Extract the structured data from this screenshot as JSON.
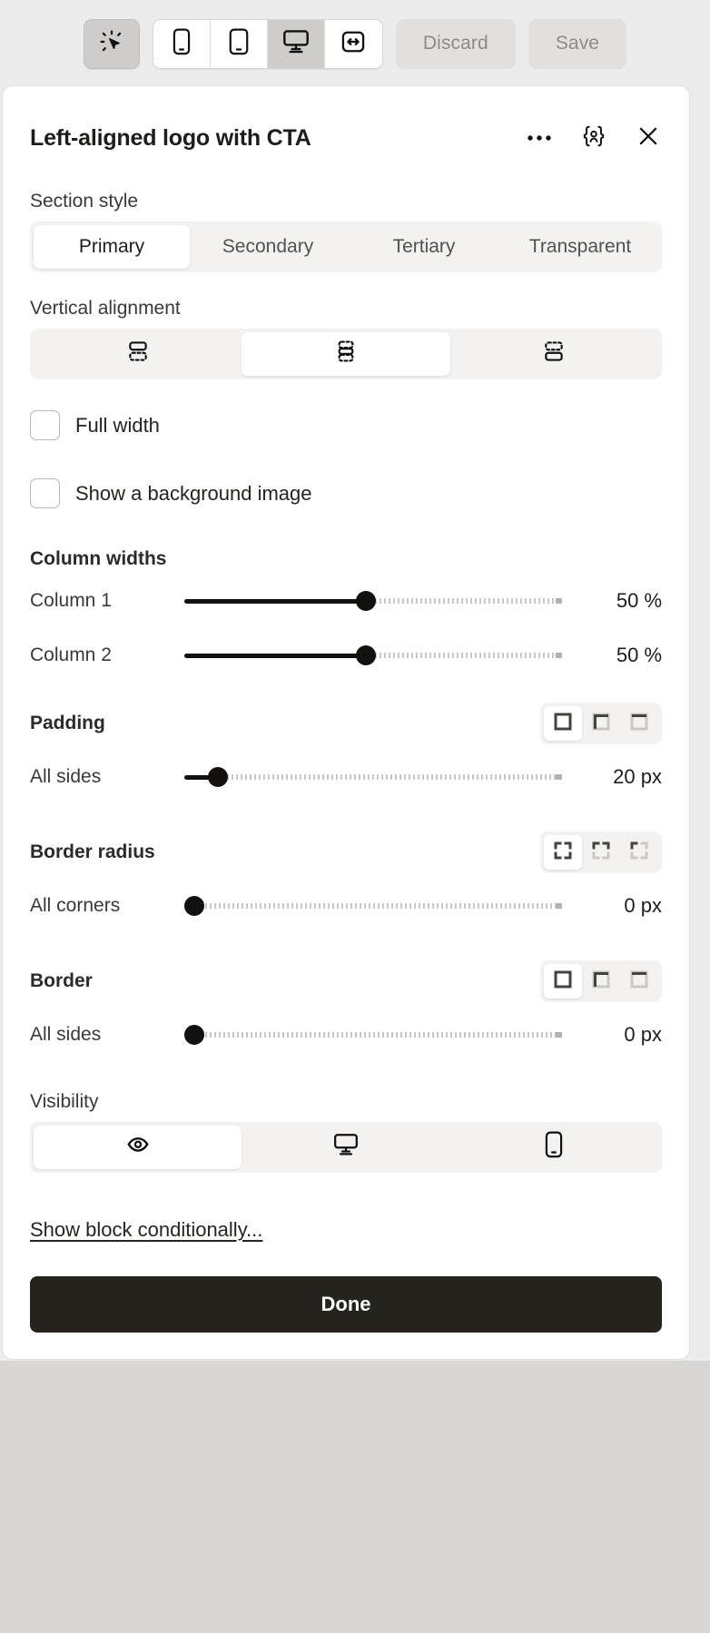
{
  "toolbar": {
    "select_tool_icon": "cursor-click-icon",
    "devices": [
      {
        "icon": "mobile-icon",
        "label": "Mobile",
        "active": false
      },
      {
        "icon": "tablet-icon",
        "label": "Tablet",
        "active": false
      },
      {
        "icon": "desktop-icon",
        "label": "Desktop",
        "active": true
      },
      {
        "icon": "responsive-icon",
        "label": "Responsive",
        "active": false
      }
    ],
    "discard_label": "Discard",
    "save_label": "Save"
  },
  "panel": {
    "title": "Left-aligned logo with CTA",
    "actions": [
      {
        "icon": "ellipsis-icon",
        "name": "more-options"
      },
      {
        "icon": "personalize-icon",
        "name": "personalization"
      },
      {
        "icon": "close-icon",
        "name": "close"
      }
    ],
    "section_style": {
      "label": "Section style",
      "options": [
        "Primary",
        "Secondary",
        "Tertiary",
        "Transparent"
      ],
      "selected": "Primary"
    },
    "vertical_alignment": {
      "label": "Vertical alignment",
      "options": [
        "align-top-icon",
        "align-middle-icon",
        "align-bottom-icon"
      ],
      "selected_index": 1
    },
    "checkboxes": [
      {
        "label": "Full width",
        "checked": false
      },
      {
        "label": "Show a background image",
        "checked": false
      }
    ],
    "column_widths": {
      "title": "Column widths",
      "rows": [
        {
          "label": "Column 1",
          "value": "50",
          "unit": "%",
          "percent": 50
        },
        {
          "label": "Column 2",
          "value": "50",
          "unit": "%",
          "percent": 50
        }
      ]
    },
    "padding": {
      "title": "Padding",
      "modes": [
        "all-sides-icon",
        "symmetric-sides-icon",
        "individual-sides-icon"
      ],
      "selected_index": 0,
      "row": {
        "label": "All sides",
        "value": "20",
        "unit": "px",
        "percent": 8
      }
    },
    "border_radius": {
      "title": "Border radius",
      "modes": [
        "all-corners-icon",
        "symmetric-corners-icon",
        "individual-corners-icon"
      ],
      "selected_index": 0,
      "row": {
        "label": "All corners",
        "value": "0",
        "unit": "px",
        "percent": 0
      }
    },
    "border": {
      "title": "Border",
      "modes": [
        "all-sides-icon",
        "symmetric-sides-icon",
        "individual-sides-icon"
      ],
      "selected_index": 0,
      "row": {
        "label": "All sides",
        "value": "0",
        "unit": "px",
        "percent": 0
      }
    },
    "visibility": {
      "label": "Visibility",
      "options": [
        "eye-icon",
        "desktop-icon",
        "mobile-icon"
      ],
      "selected_index": 0
    },
    "conditional_link": "Show block conditionally...",
    "done_label": "Done"
  }
}
